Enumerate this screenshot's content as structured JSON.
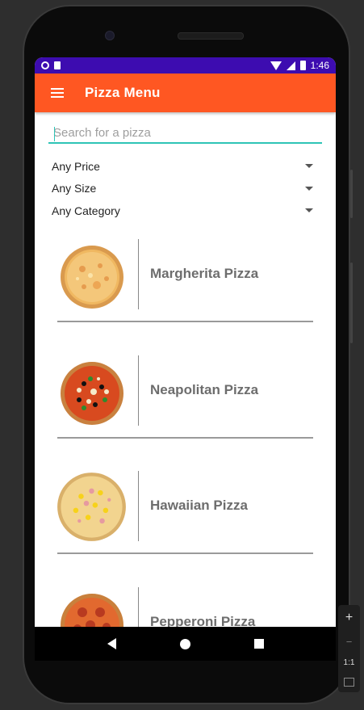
{
  "status_bar": {
    "time": "1:46"
  },
  "app_bar": {
    "title": "Pizza Menu"
  },
  "search": {
    "placeholder": "Search for a pizza",
    "value": ""
  },
  "filters": [
    {
      "label": "Any Price"
    },
    {
      "label": "Any Size"
    },
    {
      "label": "Any Category"
    }
  ],
  "pizzas": [
    {
      "name": "Margherita Pizza"
    },
    {
      "name": "Neapolitan Pizza"
    },
    {
      "name": "Hawaiian Pizza"
    },
    {
      "name": "Pepperoni Pizza"
    }
  ],
  "emulator_controls": {
    "plus": "+",
    "minus": "−",
    "ratio": "1:1"
  },
  "colors": {
    "status_bar": "#3d0cb0",
    "app_bar": "#ff5722",
    "accent": "#2ec4b6"
  }
}
